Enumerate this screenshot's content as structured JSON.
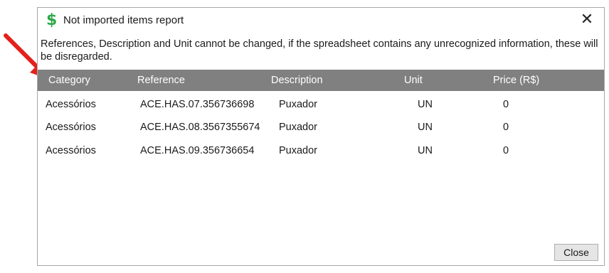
{
  "dialog": {
    "title": "Not imported items report",
    "close_glyph": "✕",
    "icon": "dollar-icon",
    "message": "References, Description and Unit cannot be changed, if the spreadsheet contains any unrecognized information, these will be disregarded.",
    "close_button_label": "Close"
  },
  "table": {
    "columns": [
      "Category",
      "Reference",
      "Description",
      "Unit",
      "Price (R$)"
    ],
    "rows": [
      [
        "Acessórios",
        "ACE.HAS.07.356736698",
        "Puxador",
        "UN",
        "0"
      ],
      [
        "Acessórios",
        "ACE.HAS.08.3567355674",
        "Puxador",
        "UN",
        "0"
      ],
      [
        "Acessórios",
        "ACE.HAS.09.356736654",
        "Puxador",
        "UN",
        "0"
      ]
    ]
  },
  "colors": {
    "header_bg": "#808080",
    "accent_arrow": "#e3211c",
    "icon_green": "#2ea84a"
  }
}
